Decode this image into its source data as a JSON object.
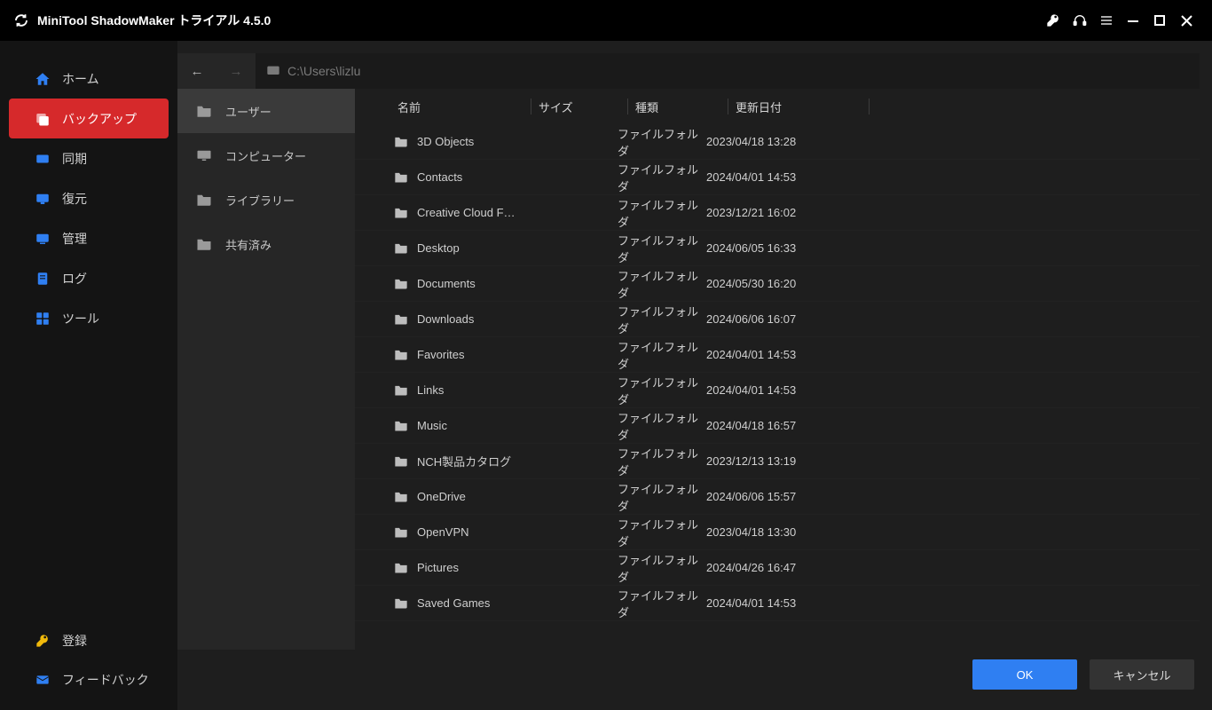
{
  "titlebar": {
    "title": "MiniTool ShadowMaker トライアル 4.5.0"
  },
  "nav": {
    "home": "ホーム",
    "backup": "バックアップ",
    "sync": "同期",
    "restore": "復元",
    "manage": "管理",
    "logs": "ログ",
    "tools": "ツール",
    "register": "登録",
    "feedback": "フィードバック"
  },
  "pathbar": {
    "path": "C:\\Users\\lizlu"
  },
  "places": {
    "user": "ユーザー",
    "computer": "コンピューター",
    "library": "ライブラリー",
    "shared": "共有済み"
  },
  "columns": {
    "name": "名前",
    "size": "サイズ",
    "type": "種類",
    "date": "更新日付"
  },
  "type_label": "ファイルフォルダ",
  "files": [
    {
      "name": "3D Objects",
      "date": "2023/04/18 13:28"
    },
    {
      "name": "Contacts",
      "date": "2024/04/01 14:53"
    },
    {
      "name": "Creative Cloud F…",
      "date": "2023/12/21 16:02"
    },
    {
      "name": "Desktop",
      "date": "2024/06/05 16:33"
    },
    {
      "name": "Documents",
      "date": "2024/05/30 16:20"
    },
    {
      "name": "Downloads",
      "date": "2024/06/06 16:07"
    },
    {
      "name": "Favorites",
      "date": "2024/04/01 14:53"
    },
    {
      "name": "Links",
      "date": "2024/04/01 14:53"
    },
    {
      "name": "Music",
      "date": "2024/04/18 16:57"
    },
    {
      "name": "NCH製品カタログ",
      "date": "2023/12/13 13:19"
    },
    {
      "name": "OneDrive",
      "date": "2024/06/06 15:57"
    },
    {
      "name": "OpenVPN",
      "date": "2023/04/18 13:30"
    },
    {
      "name": "Pictures",
      "date": "2024/04/26 16:47"
    },
    {
      "name": "Saved Games",
      "date": "2024/04/01 14:53"
    }
  ],
  "footer": {
    "ok": "OK",
    "cancel": "キャンセル"
  }
}
